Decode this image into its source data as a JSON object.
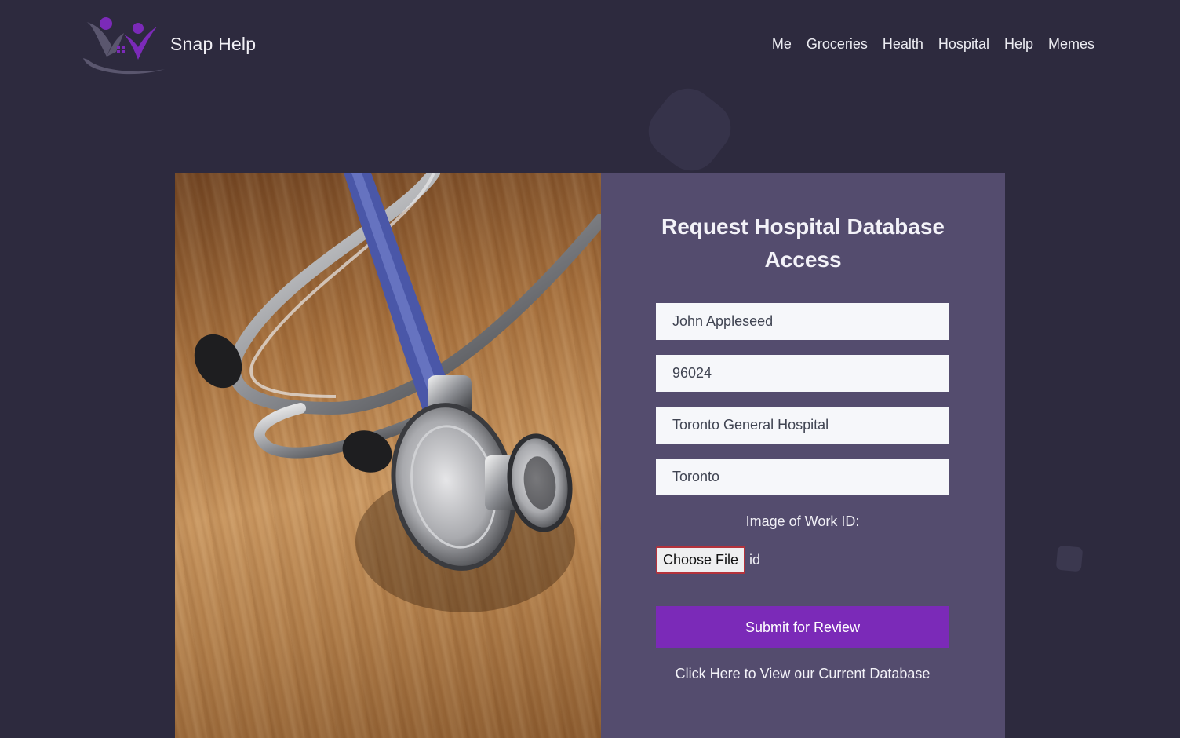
{
  "app": {
    "brand_name": "Snap Help",
    "logo_icon": "people-house-logo-icon"
  },
  "nav": {
    "items": [
      {
        "label": "Me"
      },
      {
        "label": "Groceries"
      },
      {
        "label": "Health"
      },
      {
        "label": "Hospital"
      },
      {
        "label": "Help"
      },
      {
        "label": "Memes"
      }
    ]
  },
  "hero_image": {
    "subject": "stethoscope-on-wood-photo"
  },
  "form": {
    "title": "Request Hospital Database Access",
    "fields": [
      {
        "value": "John Appleseed"
      },
      {
        "value": "96024"
      },
      {
        "value": "Toronto General Hospital"
      },
      {
        "value": "Toronto"
      }
    ],
    "upload_label": "Image of Work ID:",
    "file_button_label": "Choose File",
    "file_name": "id",
    "submit_label": "Submit for Review",
    "view_database_link": "Click Here to View our Current Database"
  },
  "colors": {
    "page_background": "#2d2a3e",
    "panel_background": "#544c6e",
    "submit_button": "#7b2ab8",
    "logo_purple": "#7b2ab8",
    "logo_gray": "#5a566e"
  }
}
